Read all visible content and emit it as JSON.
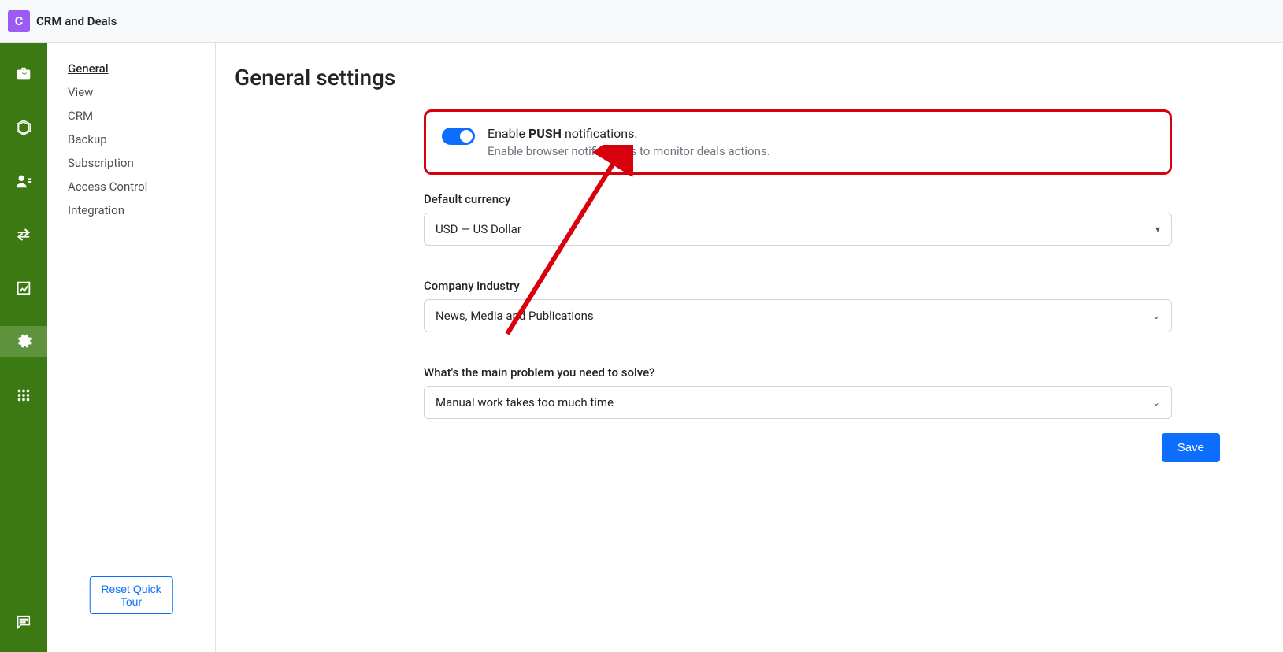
{
  "app": {
    "title": "CRM and Deals",
    "logo_letter": "C"
  },
  "iconbar": {
    "items": [
      {
        "name": "briefcase-icon"
      },
      {
        "name": "cube-icon"
      },
      {
        "name": "contacts-icon"
      },
      {
        "name": "transfer-icon"
      },
      {
        "name": "analytics-icon"
      },
      {
        "name": "gear-icon",
        "active": true
      },
      {
        "name": "apps-icon"
      }
    ],
    "bottom": {
      "name": "chat-icon"
    }
  },
  "sidemenu": {
    "items": [
      {
        "label": "General",
        "active": true
      },
      {
        "label": "View"
      },
      {
        "label": "CRM"
      },
      {
        "label": "Backup"
      },
      {
        "label": "Subscription"
      },
      {
        "label": "Access Control"
      },
      {
        "label": "Integration"
      }
    ],
    "reset_label": "Reset Quick Tour"
  },
  "page": {
    "heading": "General settings",
    "push": {
      "title_before": "Enable ",
      "title_bold": "PUSH",
      "title_after": " notifications.",
      "desc": "Enable browser notifications to monitor deals actions.",
      "enabled": true
    },
    "currency": {
      "label": "Default currency",
      "value": "USD — US Dollar"
    },
    "industry": {
      "label": "Company industry",
      "value": "News, Media and Publications"
    },
    "problem": {
      "label": "What's the main problem you need to solve?",
      "value": "Manual work takes too much time"
    },
    "save_label": "Save"
  }
}
